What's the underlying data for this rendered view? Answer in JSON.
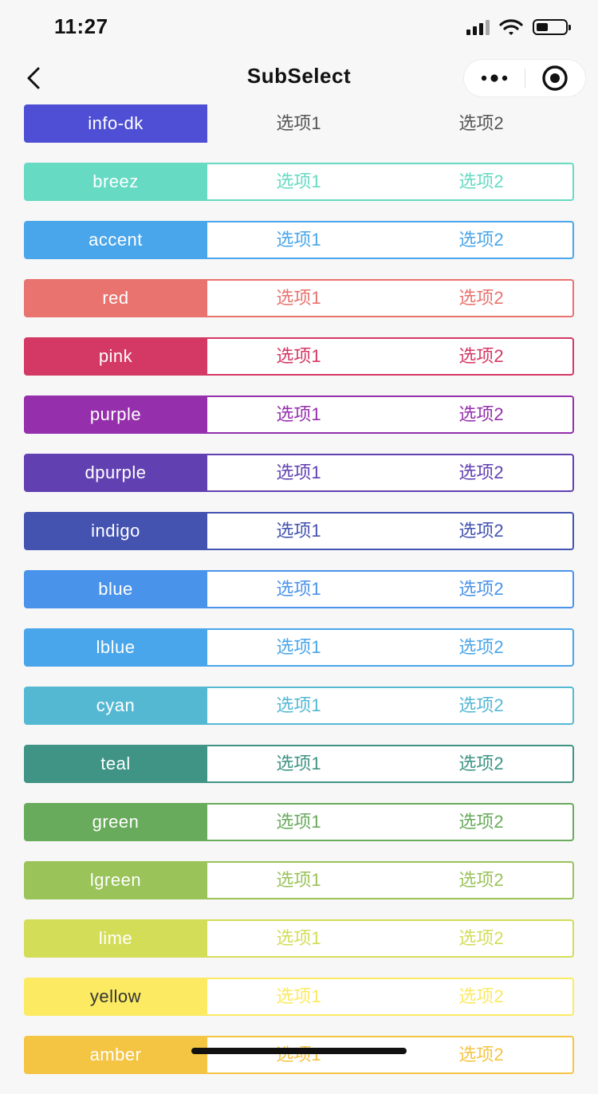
{
  "status_bar": {
    "time": "11:27"
  },
  "nav": {
    "title": "SubSelect"
  },
  "rows": [
    {
      "label": "info-dk",
      "color": "#4f4fd6",
      "option1": "选项1",
      "option2": "选项2",
      "outlined": false
    },
    {
      "label": "breez",
      "color": "#66dac3",
      "option1": "选项1",
      "option2": "选项2",
      "outlined": true
    },
    {
      "label": "accent",
      "color": "#4aa6ea",
      "option1": "选项1",
      "option2": "选项2",
      "outlined": true
    },
    {
      "label": "red",
      "color": "#e9736f",
      "option1": "选项1",
      "option2": "选项2",
      "outlined": true
    },
    {
      "label": "pink",
      "color": "#d43864",
      "option1": "选项1",
      "option2": "选项2",
      "outlined": true
    },
    {
      "label": "purple",
      "color": "#952fac",
      "option1": "选项1",
      "option2": "选项2",
      "outlined": true
    },
    {
      "label": "dpurple",
      "color": "#6141b2",
      "option1": "选项1",
      "option2": "选项2",
      "outlined": true
    },
    {
      "label": "indigo",
      "color": "#4453b0",
      "option1": "选项1",
      "option2": "选项2",
      "outlined": true
    },
    {
      "label": "blue",
      "color": "#4a93ea",
      "option1": "选项1",
      "option2": "选项2",
      "outlined": true
    },
    {
      "label": "lblue",
      "color": "#4aa6ea",
      "option1": "选项1",
      "option2": "选项2",
      "outlined": true
    },
    {
      "label": "cyan",
      "color": "#55b8d3",
      "option1": "选项1",
      "option2": "选项2",
      "outlined": true
    },
    {
      "label": "teal",
      "color": "#3f9486",
      "option1": "选项1",
      "option2": "选项2",
      "outlined": true
    },
    {
      "label": "green",
      "color": "#69ab5c",
      "option1": "选项1",
      "option2": "选项2",
      "outlined": true
    },
    {
      "label": "lgreen",
      "color": "#9ac35a",
      "option1": "选项1",
      "option2": "选项2",
      "outlined": true
    },
    {
      "label": "lime",
      "color": "#d3dd58",
      "option1": "选项1",
      "option2": "选项2",
      "outlined": true
    },
    {
      "label": "yellow",
      "color": "#fbea62",
      "option1": "选项1",
      "option2": "选项2",
      "outlined": true,
      "label_text_color": "#333333"
    },
    {
      "label": "amber",
      "color": "#f4c443",
      "option1": "选项1",
      "option2": "选项2",
      "outlined": true
    }
  ],
  "icons": {
    "back": "chevron-left-icon",
    "more": "more-dots-icon",
    "close": "target-circle-icon",
    "signal": "cellular-signal-icon",
    "wifi": "wifi-icon",
    "battery": "battery-icon"
  }
}
